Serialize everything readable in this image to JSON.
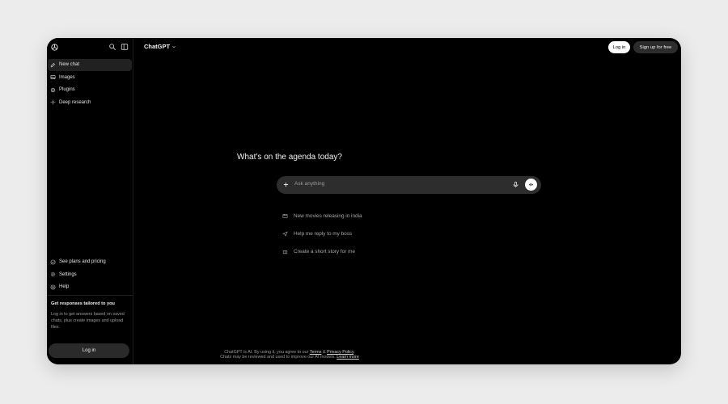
{
  "sidebar": {
    "nav": [
      {
        "label": "New chat",
        "icon": "new-chat-icon"
      },
      {
        "label": "Images",
        "icon": "images-icon"
      },
      {
        "label": "Plugins",
        "icon": "plugins-icon"
      },
      {
        "label": "Deep research",
        "icon": "deep-research-icon"
      }
    ],
    "bottom": [
      {
        "label": "See plans and pricing",
        "icon": "plans-icon"
      },
      {
        "label": "Settings",
        "icon": "settings-icon"
      },
      {
        "label": "Help",
        "icon": "help-icon"
      }
    ],
    "promo_title": "Get responses tailored to you",
    "promo_desc": "Log in to get answers based on saved chats, plus create images and upload files.",
    "login_label": "Log in"
  },
  "header": {
    "model_label": "ChatGPT",
    "login_label": "Log in",
    "signup_label": "Sign up for free"
  },
  "main": {
    "headline": "What’s on the agenda today?",
    "composer_placeholder": "Ask anything",
    "suggestions": [
      {
        "label": "New movies releasing in india",
        "icon": "film-icon"
      },
      {
        "label": "Help me reply to my boss",
        "icon": "send-icon"
      },
      {
        "label": "Create a short story for me",
        "icon": "gift-icon"
      }
    ]
  },
  "footer": {
    "line1_prefix": "ChatGPT is AI. By using it, you agree to our ",
    "terms": "Terms",
    "and": " & ",
    "privacy": "Privacy Policy",
    "line1_suffix": ".",
    "line2_prefix": "Chats may be reviewed and used to improve our AI models. ",
    "learn_more": "Learn more"
  },
  "colors": {
    "background": "#000000",
    "surface": "#2d2d2d",
    "page_bg": "#ececec"
  }
}
